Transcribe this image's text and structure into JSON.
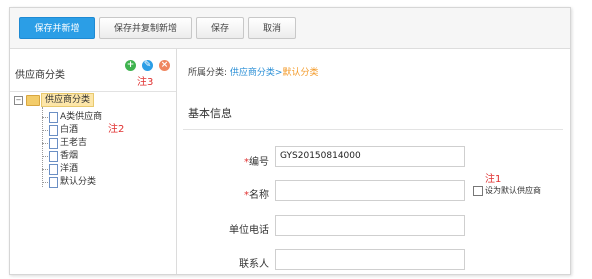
{
  "toolbar": {
    "save_and_new": "保存并新增",
    "save_copy_new": "保存并复制新增",
    "save": "保存",
    "cancel": "取消"
  },
  "left_panel": {
    "title": "供应商分类",
    "icons": [
      "add-icon",
      "edit-icon",
      "delete-icon"
    ],
    "note3": "注3",
    "note2": "注2",
    "tree": {
      "root": "供应商分类",
      "children": [
        "A类供应商",
        "白酒",
        "王老吉",
        "香烟",
        "洋酒",
        "默认分类"
      ]
    }
  },
  "breadcrumb": {
    "prefix": "所属分类:",
    "parent": "供应商分类>",
    "current": "默认分类"
  },
  "form": {
    "section_title": "基本信息",
    "code_label": "编号",
    "code_value": "GYS20150814000",
    "name_label": "名称",
    "name_value": "",
    "phone_label": "单位电话",
    "phone_value": "",
    "contact_label": "联系人",
    "contact_value": "",
    "default_supplier_label": "设为默认供应商",
    "note1": "注1"
  },
  "colors": {
    "primary": "#2b9ee6",
    "link": "#2b8fd6",
    "current_crumb": "#f39b2b",
    "note": "#e03030",
    "add_icon": "#3fb34f",
    "edit_icon": "#2b9ee6",
    "delete_icon": "#ef8660"
  }
}
